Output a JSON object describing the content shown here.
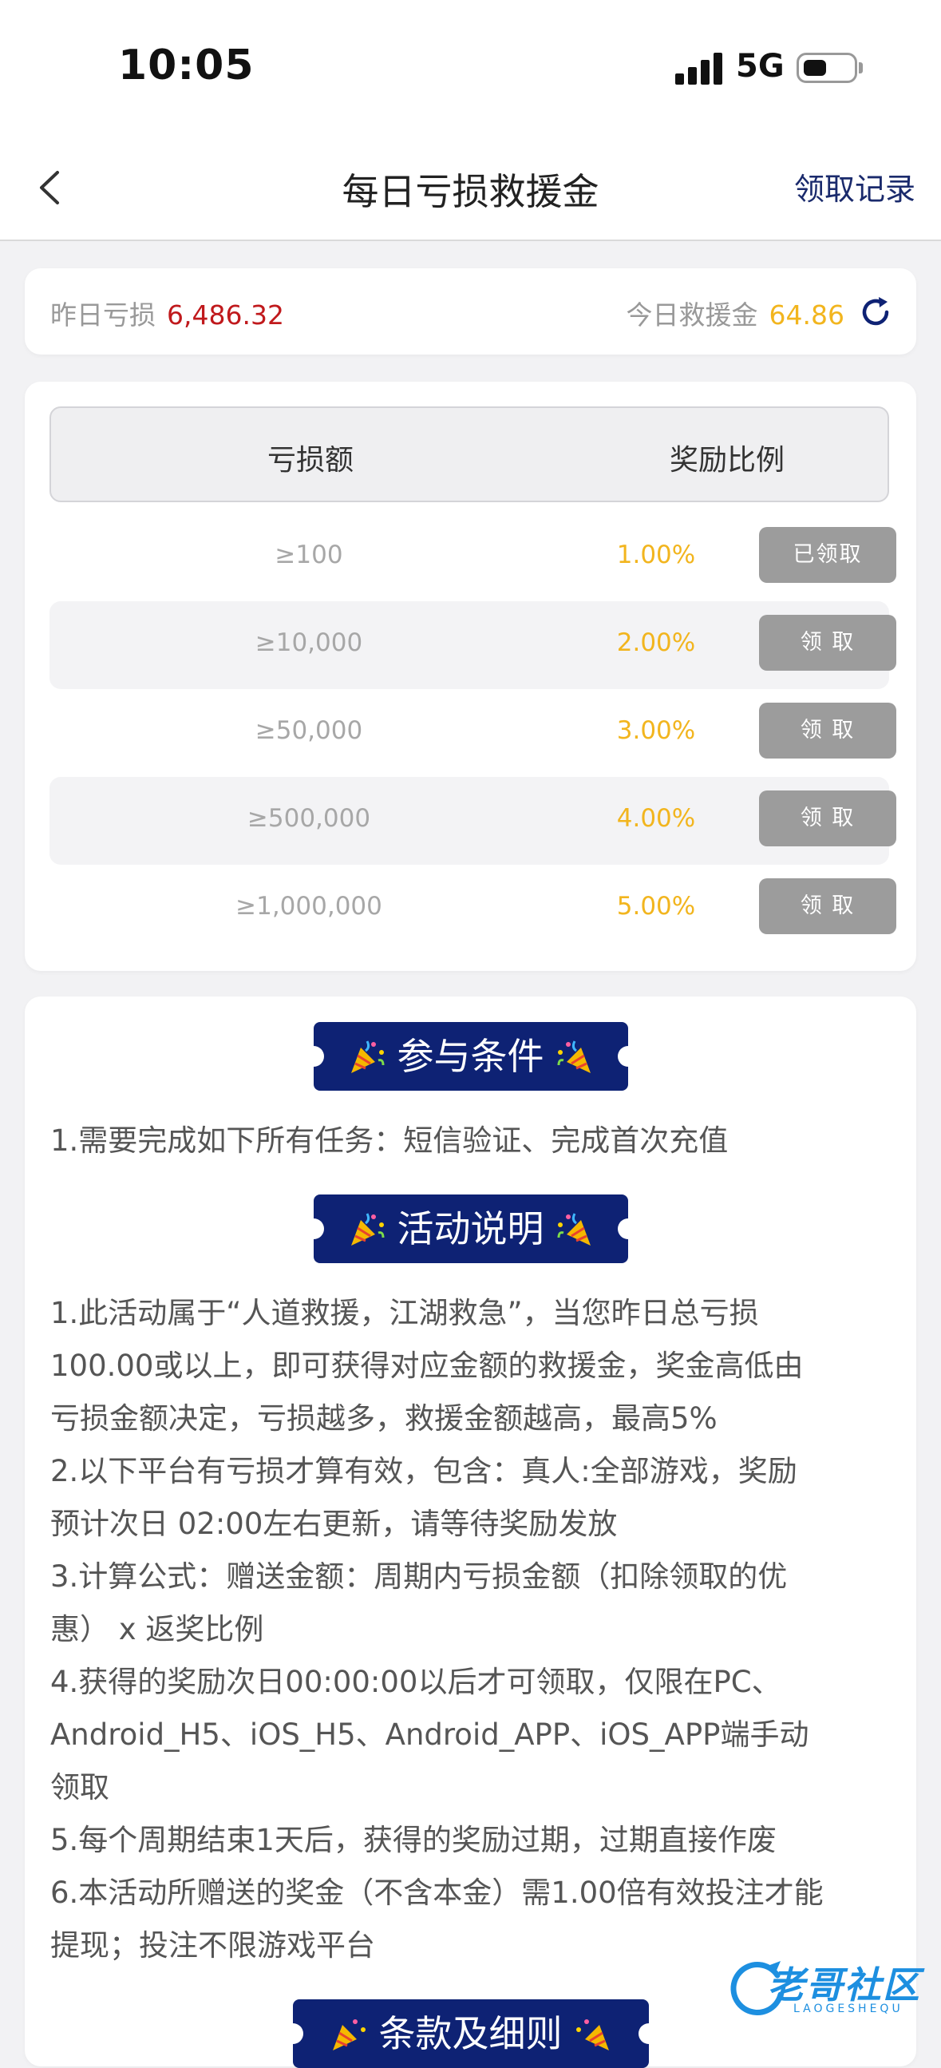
{
  "status_bar": {
    "time": "10:05",
    "network": "5G"
  },
  "nav": {
    "title": "每日亏损救援金",
    "records_link": "领取记录"
  },
  "summary": {
    "yesterday_loss_label": "昨日亏损",
    "yesterday_loss_value": "6,486.32",
    "today_rescue_label": "今日救援金",
    "today_rescue_value": "64.86"
  },
  "tier_table": {
    "col_loss": "亏损额",
    "col_ratio": "奖励比例",
    "rows": [
      {
        "amount": "≥100",
        "ratio": "1.00%",
        "button": "已领取"
      },
      {
        "amount": "≥10,000",
        "ratio": "2.00%",
        "button": "领 取"
      },
      {
        "amount": "≥50,000",
        "ratio": "3.00%",
        "button": "领 取"
      },
      {
        "amount": "≥500,000",
        "ratio": "4.00%",
        "button": "领 取"
      },
      {
        "amount": "≥1,000,000",
        "ratio": "5.00%",
        "button": "领 取"
      }
    ]
  },
  "rules": {
    "conditions_title": "参与条件",
    "conditions": [
      "1.需要完成如下所有任务：短信验证、完成首次充值"
    ],
    "description_title": "活动说明",
    "description_lines": [
      "1.此活动属于“人道救援，江湖救急”，当您昨日总亏损",
      "100.00或以上，即可获得对应金额的救援金，奖金高低由",
      "亏损金额决定，亏损越多，救援金额越高，最高5%",
      "2.以下平台有亏损才算有效，包含：真人:全部游戏，奖励",
      "预计次日 02:00左右更新，请等待奖励发放",
      "3.计算公式：赠送金额：周期内亏损金额（扣除领取的优",
      "惠） x 返奖比例",
      "4.获得的奖励次日00:00:00以后才可领取，仅限在PC、",
      "Android_H5、iOS_H5、Android_APP、iOS_APP端手动",
      "领取",
      "5.每个周期结束1天后，获得的奖励过期，过期直接作废",
      "6.本活动所赠送的奖金（不含本金）需1.00倍有效投注才能",
      "提现；投注不限游戏平台"
    ],
    "terms_title": "条款及细则"
  },
  "watermark": {
    "title": "老哥社区",
    "subtitle": "LAOGESHEQU"
  },
  "colors": {
    "loss_red": "#c0191c",
    "gold": "#f2b51e",
    "navy": "#0e2274",
    "button_gray": "#9c9c9c"
  }
}
